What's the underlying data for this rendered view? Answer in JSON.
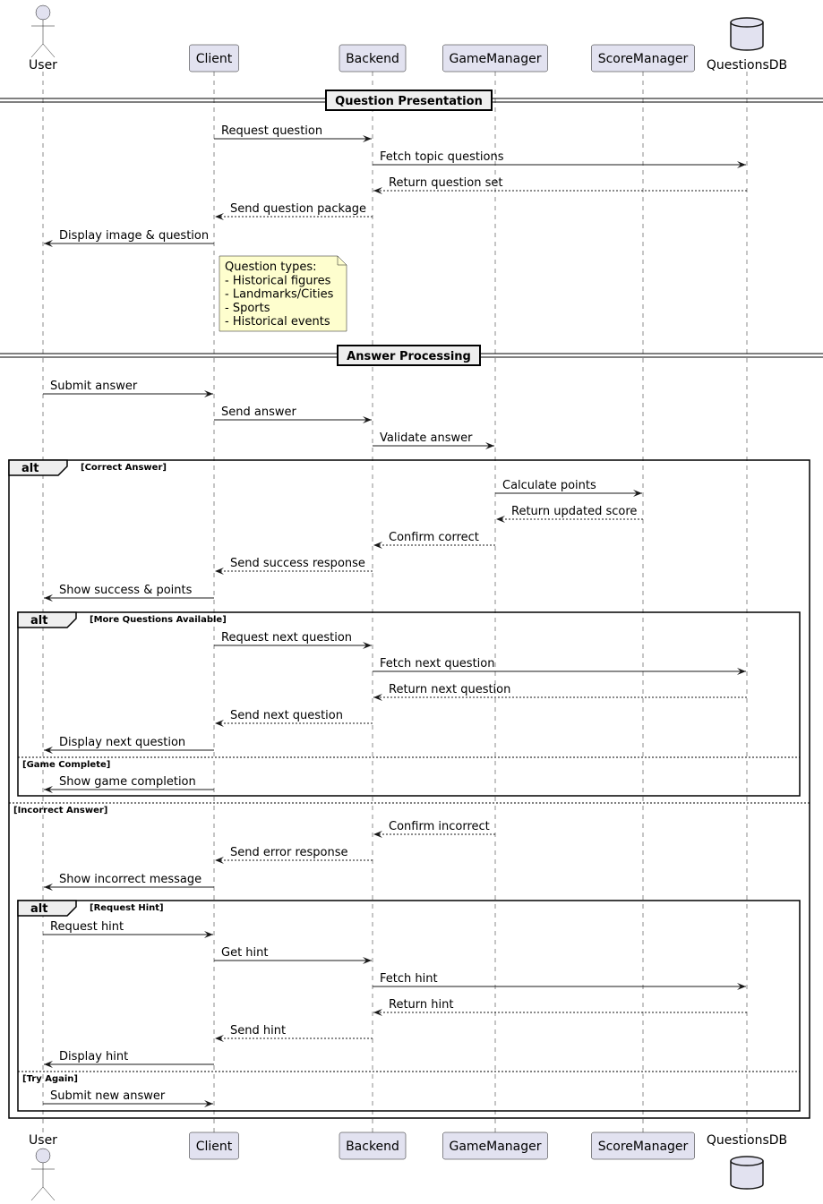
{
  "colors": {
    "participant_fill": "#e2e2f0",
    "participant_stroke": "#181818",
    "note_fill": "#fefece",
    "divider_fill": "#eeeeee"
  },
  "participants": [
    {
      "id": "user",
      "name": "User",
      "kind": "actor"
    },
    {
      "id": "client",
      "name": "Client",
      "kind": "participant"
    },
    {
      "id": "backend",
      "name": "Backend",
      "kind": "participant"
    },
    {
      "id": "gm",
      "name": "GameManager",
      "kind": "participant"
    },
    {
      "id": "sm",
      "name": "ScoreManager",
      "kind": "participant"
    },
    {
      "id": "db",
      "name": "QuestionsDB",
      "kind": "database"
    }
  ],
  "dividers": [
    "Question Presentation",
    "Answer Processing"
  ],
  "note": {
    "lines": [
      "Question types:",
      "- Historical figures",
      "- Landmarks/Cities",
      "- Sports",
      "- Historical events"
    ]
  },
  "messages": [
    {
      "from": "client",
      "to": "backend",
      "label": "Request question",
      "dashed": false
    },
    {
      "from": "backend",
      "to": "db",
      "label": "Fetch topic questions",
      "dashed": false
    },
    {
      "from": "db",
      "to": "backend",
      "label": "Return question set",
      "dashed": true
    },
    {
      "from": "backend",
      "to": "client",
      "label": "Send question package",
      "dashed": true
    },
    {
      "from": "client",
      "to": "user",
      "label": "Display image & question",
      "dashed": false
    },
    {
      "from": "user",
      "to": "client",
      "label": "Submit answer",
      "dashed": false
    },
    {
      "from": "client",
      "to": "backend",
      "label": "Send answer",
      "dashed": false
    },
    {
      "from": "backend",
      "to": "gm",
      "label": "Validate answer",
      "dashed": false
    },
    {
      "from": "gm",
      "to": "sm",
      "label": "Calculate points",
      "dashed": false
    },
    {
      "from": "sm",
      "to": "gm",
      "label": "Return updated score",
      "dashed": true
    },
    {
      "from": "gm",
      "to": "backend",
      "label": "Confirm correct",
      "dashed": true
    },
    {
      "from": "backend",
      "to": "client",
      "label": "Send success response",
      "dashed": true
    },
    {
      "from": "client",
      "to": "user",
      "label": "Show success & points",
      "dashed": false
    },
    {
      "from": "client",
      "to": "backend",
      "label": "Request next question",
      "dashed": false
    },
    {
      "from": "backend",
      "to": "db",
      "label": "Fetch next question",
      "dashed": false
    },
    {
      "from": "db",
      "to": "backend",
      "label": "Return next question",
      "dashed": true
    },
    {
      "from": "backend",
      "to": "client",
      "label": "Send next question",
      "dashed": true
    },
    {
      "from": "client",
      "to": "user",
      "label": "Display next question",
      "dashed": false
    },
    {
      "from": "client",
      "to": "user",
      "label": "Show game completion",
      "dashed": false
    },
    {
      "from": "gm",
      "to": "backend",
      "label": "Confirm incorrect",
      "dashed": true
    },
    {
      "from": "backend",
      "to": "client",
      "label": "Send error response",
      "dashed": true
    },
    {
      "from": "client",
      "to": "user",
      "label": "Show incorrect message",
      "dashed": false
    },
    {
      "from": "user",
      "to": "client",
      "label": "Request hint",
      "dashed": false
    },
    {
      "from": "client",
      "to": "backend",
      "label": "Get hint",
      "dashed": false
    },
    {
      "from": "backend",
      "to": "db",
      "label": "Fetch hint",
      "dashed": false
    },
    {
      "from": "db",
      "to": "backend",
      "label": "Return hint",
      "dashed": true
    },
    {
      "from": "backend",
      "to": "client",
      "label": "Send hint",
      "dashed": true
    },
    {
      "from": "client",
      "to": "user",
      "label": "Display hint",
      "dashed": false
    },
    {
      "from": "user",
      "to": "client",
      "label": "Submit new answer",
      "dashed": false
    }
  ],
  "fragments": [
    {
      "type": "alt",
      "conditions": [
        "[Correct Answer]",
        "[Incorrect Answer]"
      ]
    },
    {
      "type": "alt",
      "conditions": [
        "[More Questions Available]",
        "[Game Complete]"
      ]
    },
    {
      "type": "alt",
      "conditions": [
        "[Request Hint]",
        "[Try Again]"
      ]
    }
  ]
}
